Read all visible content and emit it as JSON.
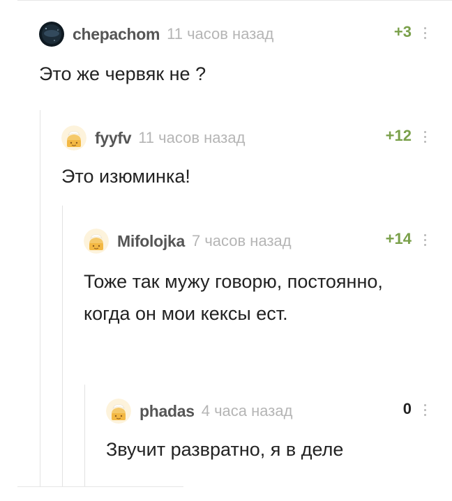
{
  "comments": [
    {
      "author": "chepachom",
      "time": "11 часов назад",
      "rating": "+3",
      "text": "Это же червяк не ?",
      "avatar": "dark-space-avatar"
    },
    {
      "author": "fyyfv",
      "time": "11 часов назад",
      "rating": "+12",
      "text": "Это изюминка!",
      "avatar": "default-cake-avatar"
    },
    {
      "author": "Mifolojka",
      "time": "7 часов назад",
      "rating": "+14",
      "text": "Тоже так мужу говорю, постоянно, когда он мои кексы ест.",
      "avatar": "default-cake-avatar"
    },
    {
      "author": "phadas",
      "time": "4 часа назад",
      "rating": "0",
      "text": "Звучит развратно, я в деле",
      "avatar": "default-cake-avatar"
    }
  ],
  "colors": {
    "rating_positive": "#7aa04a",
    "rating_zero": "#222222",
    "meta": "#b5b5b5",
    "author": "#555555"
  }
}
